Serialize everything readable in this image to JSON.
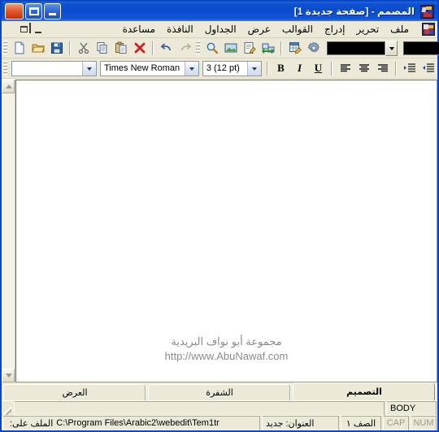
{
  "window": {
    "title": "المصمم - [صفحة جديدة 1]",
    "app_icon": "app-icon",
    "minimize_label": "تصغير",
    "maximize_label": "تكبير",
    "close_label": "إغلاق"
  },
  "menubar": {
    "items": [
      {
        "label": "ملف",
        "name": "menu-file"
      },
      {
        "label": "تحرير",
        "name": "menu-edit"
      },
      {
        "label": "إدراج",
        "name": "menu-insert"
      },
      {
        "label": "القوالب",
        "name": "menu-templates"
      },
      {
        "label": "عرض",
        "name": "menu-view"
      },
      {
        "label": "الجداول",
        "name": "menu-tables"
      },
      {
        "label": "النافذة",
        "name": "menu-window"
      },
      {
        "label": "مساعدة",
        "name": "menu-help"
      }
    ],
    "mdi_minimize": "_",
    "mdi_restore": "❐",
    "mdi_close": "✕"
  },
  "toolbar_main": {
    "buttons": [
      {
        "name": "new-document-button",
        "icon": "new-page-icon"
      },
      {
        "name": "open-file-button",
        "icon": "open-folder-icon"
      },
      {
        "name": "save-file-button",
        "icon": "floppy-save-icon"
      },
      {
        "name": "cut-button",
        "icon": "scissors-icon"
      },
      {
        "name": "copy-button",
        "icon": "copy-icon"
      },
      {
        "name": "paste-button",
        "icon": "paste-icon"
      },
      {
        "name": "delete-button",
        "icon": "red-x-icon"
      },
      {
        "name": "undo-button",
        "icon": "undo-arrow-icon"
      },
      {
        "name": "redo-button",
        "icon": "redo-arrow-icon"
      },
      {
        "name": "preview-button",
        "icon": "magnifier-icon"
      },
      {
        "name": "insert-image-button",
        "icon": "picture-icon"
      },
      {
        "name": "edit-note-button",
        "icon": "notepad-pencil-icon"
      },
      {
        "name": "insert-link-button",
        "icon": "link-arrows-icon"
      },
      {
        "name": "insert-table-button",
        "icon": "table-edit-icon"
      },
      {
        "name": "settings-button",
        "icon": "gear-icon"
      }
    ],
    "color_primary": "#000000",
    "color_secondary": "#000000"
  },
  "toolbar_format": {
    "style_value": "",
    "style_placeholder": "",
    "font_value": "Times New Roman",
    "size_value": "3 (12 pt)",
    "bold_label": "B",
    "italic_label": "I",
    "underline_label": "U",
    "align_left": "align-left-icon",
    "align_center": "align-center-icon",
    "align_right": "align-right-icon",
    "indent_increase": "indent-increase-icon",
    "indent_decrease": "indent-decrease-icon"
  },
  "document": {
    "watermark_arabic": "مجموعة أبو نواف البريدية",
    "watermark_url": "http://www.AbuNawaf.com"
  },
  "tabs": [
    {
      "label": "التصميم",
      "name": "tab-design",
      "active": true
    },
    {
      "label": "الشفرة",
      "name": "tab-code",
      "active": false
    },
    {
      "label": "العرض",
      "name": "tab-preview",
      "active": false
    }
  ],
  "status": {
    "element": "BODY",
    "element_extra": "",
    "num_lock": "NUM",
    "caps_lock": "CAP",
    "row": "الصف ١",
    "title_label": "العنوان: جديد",
    "file_label": "الملف على:",
    "file_path": "C:\\Program Files\\Arabic2\\webedit\\Tem1tr"
  }
}
